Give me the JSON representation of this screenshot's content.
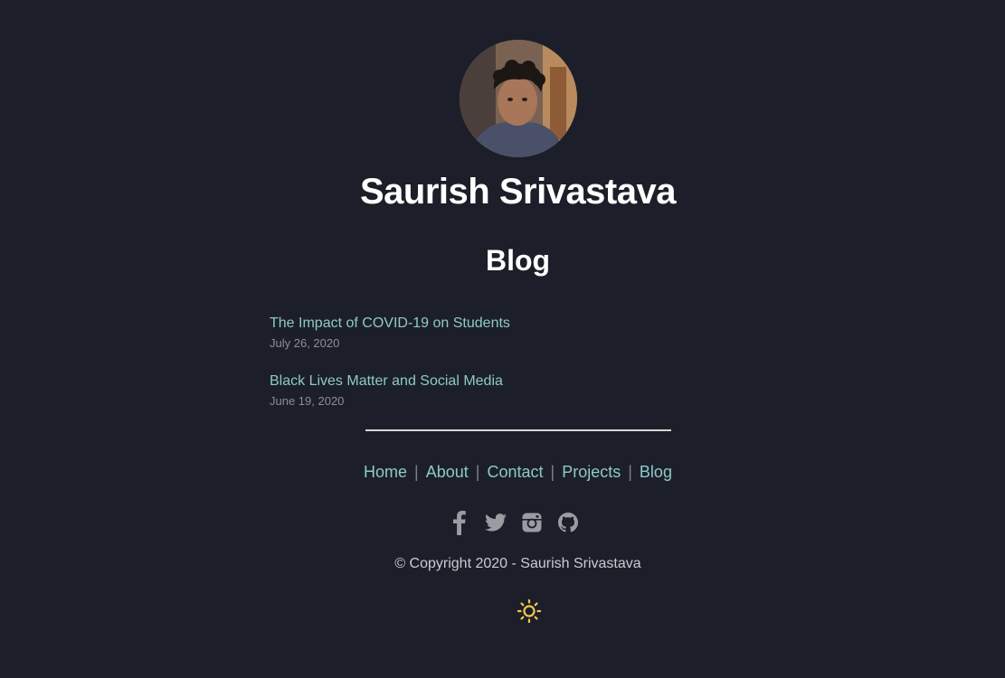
{
  "header": {
    "name": "Saurish Srivastava"
  },
  "main": {
    "heading": "Blog",
    "posts": [
      {
        "title": "The Impact of COVID-19 on Students",
        "date": "July 26, 2020"
      },
      {
        "title": "Black Lives Matter and Social Media",
        "date": "June 19, 2020"
      }
    ]
  },
  "footer": {
    "nav": [
      "Home",
      "About",
      "Contact",
      "Projects",
      "Blog"
    ],
    "separator": "|",
    "social": [
      "facebook-icon",
      "twitter-icon",
      "instagram-icon",
      "github-icon"
    ],
    "copyright": "© Copyright 2020 - Saurish Srivastava",
    "theme_toggle_icon": "sun-icon"
  },
  "colors": {
    "background": "#1c1f29",
    "link": "#8fc9c8",
    "icon": "#9a9ca3",
    "sun": "#f2c94c"
  }
}
